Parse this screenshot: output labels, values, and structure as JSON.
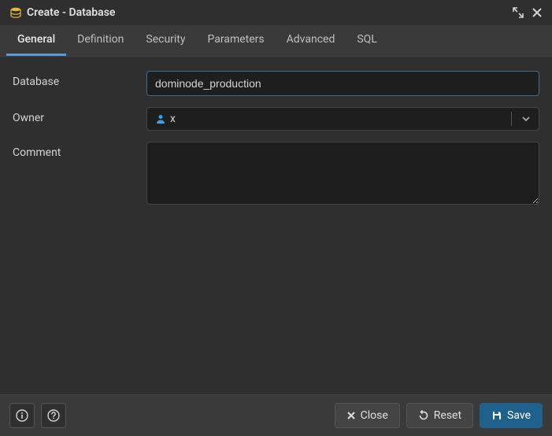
{
  "titlebar": {
    "title": "Create - Database"
  },
  "tabs": [
    {
      "label": "General",
      "active": true
    },
    {
      "label": "Definition",
      "active": false
    },
    {
      "label": "Security",
      "active": false
    },
    {
      "label": "Parameters",
      "active": false
    },
    {
      "label": "Advanced",
      "active": false
    },
    {
      "label": "SQL",
      "active": false
    }
  ],
  "form": {
    "database": {
      "label": "Database",
      "value": "dominode_production"
    },
    "owner": {
      "label": "Owner",
      "value": "x"
    },
    "comment": {
      "label": "Comment",
      "value": ""
    }
  },
  "footer": {
    "close": "Close",
    "reset": "Reset",
    "save": "Save"
  }
}
